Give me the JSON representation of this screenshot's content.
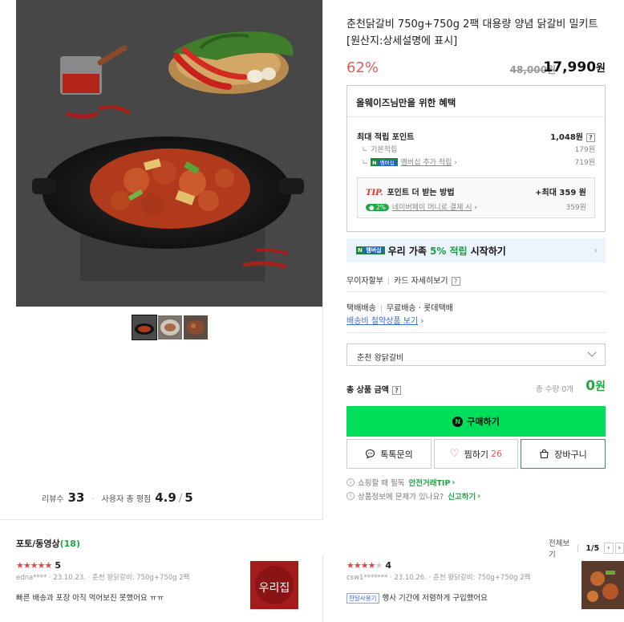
{
  "product": {
    "title": "춘천닭갈비 750g+750g 2팩 대용량 양념 닭갈비 밀키트 [원산지:상세설명에 표시]",
    "discount": "62%",
    "original_price": "48,000원",
    "sale_price": "17,990",
    "sale_price_unit": "원"
  },
  "gallery": {
    "thumbnails": [
      "thumb-1",
      "thumb-2",
      "thumb-3"
    ],
    "review_label": "리뷰수",
    "review_count": "33",
    "rating_label": "사용자 총 평점",
    "rating": "4.9",
    "rating_max": "5"
  },
  "benefits": {
    "title": "올웨이즈님만을 위한 혜택",
    "max_points_label": "최대 적립 포인트",
    "max_points": "1,048원",
    "basic_label": "기본적립",
    "basic_value": "179원",
    "member_badge_n": "N",
    "member_badge": "멤버십",
    "member_label": "멤버십 추가 적립",
    "member_value": "719원",
    "tip_logo": "TIP.",
    "tip_label": "포인트 더 받는 방법",
    "tip_max": "+최대 359 원",
    "naverpay_pct": "2%",
    "naverpay_label": "네이버페이 머니로 결제 시",
    "naverpay_value": "359원"
  },
  "membership_banner": {
    "badge": "멤버십",
    "text_before": "우리 가족",
    "highlight": "5% 적립",
    "text_after": "시작하기",
    "arrow": "›"
  },
  "payment": {
    "installment": "무이자할부",
    "card_detail": "카드 자세히보기",
    "qmark": "?"
  },
  "shipping": {
    "type": "택배배송",
    "free": "무료배송",
    "courier": "롯데택배",
    "saving_link": "배송비 절약상품 보기"
  },
  "option": {
    "selected": "춘천 왕닭갈비"
  },
  "total": {
    "label": "총 상품 금액",
    "qty": "총 수량 0개",
    "price": "0",
    "unit": "원"
  },
  "buttons": {
    "buy": "구매하기",
    "talk": "톡톡문의",
    "wish": "찜하기",
    "wish_count": "26",
    "cart": "장바구니"
  },
  "notices": {
    "line1": "쇼핑할 때 필독",
    "line1_link": "안전거래TIP",
    "line2": "상품정보에 문제가 있나요?",
    "line2_link": "신고하기"
  },
  "reviews_section": {
    "title": "포토/동영상",
    "count": "(18)",
    "view_all": "전체보기",
    "page": "1/5",
    "prev": "‹",
    "next": "›"
  },
  "reviews": [
    {
      "stars": 5,
      "score": "5",
      "user": "edna****",
      "date": "23.10.23.",
      "option": "춘천 왕닭갈비: 750g+750g 2팩",
      "text": "빠른 배송과 포장 아직 먹어보진 못했어요 ㅠㅠ",
      "thumb_text": "우리집"
    },
    {
      "stars": 4,
      "score": "4",
      "user": "csw1*******",
      "date": "23.10.26.",
      "option": "춘천 왕닭갈비: 750g+750g 2팩",
      "badge": "한달사용기",
      "text": "행사 기간에 저렴하게 구입했어요"
    }
  ],
  "icons": {
    "chevron": "chevron-down-icon",
    "chat": "chat-bubble-icon",
    "heart": "heart-icon",
    "cart": "shopping-bag-icon",
    "info": "info-icon"
  },
  "colors": {
    "accent_green": "#00de5a",
    "discount_red": "#e05c5c",
    "link_blue": "#3a6ad4"
  }
}
